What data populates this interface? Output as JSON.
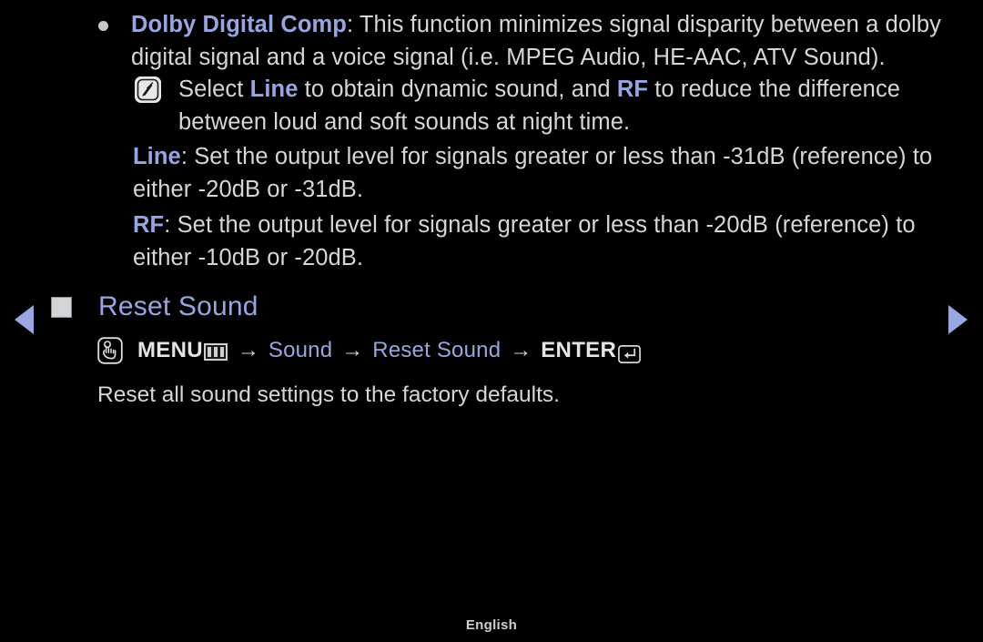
{
  "screen": {
    "background": "#000000",
    "body_text_color": "#d6d6d6",
    "accent_color": "#97a6e2",
    "arrow_color": "#9aa8e2"
  },
  "bullet": {
    "term": "Dolby Digital Comp",
    "colon": ":",
    "text": " This function minimizes signal disparity between a dolby digital signal and a voice signal (i.e. MPEG Audio, HE-AAC, ATV Sound)."
  },
  "note": {
    "icon": "note-pen-icon",
    "text_1": "Select ",
    "term_1": "Line",
    "text_2": " to obtain dynamic sound, and ",
    "term_2": "RF",
    "text_3": " to reduce the difference between loud and soft sounds at night time."
  },
  "line_para": {
    "term": "Line",
    "colon": ":",
    "text": " Set the output level for signals greater or less than -31dB (reference) to either -20dB or -31dB."
  },
  "rf_para": {
    "term": "RF",
    "colon": ":",
    "text": " Set the output level for signals greater or less than -20dB (reference) to either -10dB or -20dB."
  },
  "nav": {
    "prev_label": "◀",
    "next_label": "▶"
  },
  "section": {
    "title": "Reset Sound",
    "bullet_square": "gray-square-marker"
  },
  "menu_path": {
    "icon": "hand-pointer-icon",
    "menu_label": "MENU",
    "menu_glyph": "menu-grid-icon",
    "arrow_1": "→",
    "item_1": "Sound",
    "arrow_2": "→",
    "item_2": "Reset Sound",
    "arrow_3": "→",
    "enter_label": "ENTER",
    "enter_glyph": "enter-return-icon"
  },
  "description": "Reset all sound settings to the factory defaults.",
  "footer": {
    "language": "English"
  }
}
